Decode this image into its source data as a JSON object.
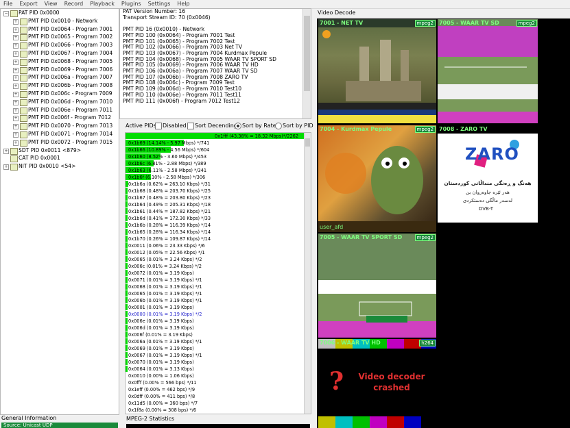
{
  "menu": [
    "File",
    "Export",
    "View",
    "Record",
    "Playback",
    "Plugins",
    "Settings",
    "Help"
  ],
  "tree": {
    "root": "PAT PID 0x0000",
    "children": [
      "PMT PID 0x0010 - Network",
      "PMT PID 0x0064 - Program 7001",
      "PMT PID 0x0065 - Program 7002",
      "PMT PID 0x0066 - Program 7003",
      "PMT PID 0x0067 - Program 7004",
      "PMT PID 0x0068 - Program 7005",
      "PMT PID 0x0069 - Program 7006",
      "PMT PID 0x006a - Program 7007",
      "PMT PID 0x006b - Program 7008",
      "PMT PID 0x006c - Program 7009",
      "PMT PID 0x006d - Program 7010",
      "PMT PID 0x006e - Program 7011",
      "PMT PID 0x006f - Program 7012",
      "PMT PID 0x0070 - Program 7013",
      "PMT PID 0x0071 - Program 7014",
      "PMT PID 0x0072 - Program 7015"
    ],
    "others": [
      "SDT PID 0x0011 <879>",
      "CAT PID 0x0001",
      "NIT PID 0x0010 <54>"
    ]
  },
  "general": {
    "label": "General Information",
    "source": "Source: Unicast UDP"
  },
  "pat_info": [
    "PAT Version Number: 16",
    "Transport Stream ID: 70 (0x0046)",
    "",
    "PMT PID 16 (0x0010) - Network",
    "PMT PID 100 (0x0064) - Program 7001 Test",
    "PMT PID 101 (0x0065) - Program 7002 Test",
    "PMT PID 102 (0x0066) - Program 7003 Net TV",
    "PMT PID 103 (0x0067) - Program 7004 Kurdmax Pepule",
    "PMT PID 104 (0x0068) - Program 7005 WAAR TV SPORT SD",
    "PMT PID 105 (0x0069) - Program 7006 WAAR TV HD",
    "PMT PID 106 (0x006a) - Program 7007 WAAR TV SD",
    "PMT PID 107 (0x006b) - Program 7008 ZARO TV",
    "PMT PID 108 (0x006c) - Program 7009 Test",
    "PMT PID 109 (0x006d) - Program 7010 Test10",
    "PMT PID 110 (0x006e) - Program 7011 Test11",
    "PMT PID 111 (0x006f) - Program 7012 Test12"
  ],
  "active": {
    "label": "Active PIDs",
    "disabled": "Disabled",
    "sort_desc": "Sort Decending",
    "sort_rate": "Sort by Rate",
    "sort_pid": "Sort by PID"
  },
  "pids": [
    {
      "t": "0x1fff (43.38% = 18.32 Mbps)*/2262",
      "p": 43.38
    },
    {
      "t": "0x1b69 (14.14% - 5.97 Mbps) */741",
      "p": 14.14
    },
    {
      "t": "0x1b66 (10.89% - 4.56 Mbps) */604",
      "p": 10.89
    },
    {
      "t": "0x1b60 (8.52% - 3.60 Mbps) */453",
      "p": 8.52
    },
    {
      "t": "0x1b6c (6.81% - 2.88 Mbps) */389",
      "p": 6.81
    },
    {
      "t": "0x1b63 (6.11% - 2.58 Mbps) */341",
      "p": 6.11
    },
    {
      "t": "0x1b6f (6.10% - 2.58 Mbps) */306",
      "p": 6.1
    },
    {
      "t": "0x1b6a (0.62% = 263.10 Kbps) */31",
      "p": 0.62
    },
    {
      "t": "0x1b68 (0.48% = 203.70 Kbps) */25",
      "p": 0.48
    },
    {
      "t": "0x1b67 (0.48% = 203.80 Kbps) */23",
      "p": 0.48
    },
    {
      "t": "0x1b64 (0.49% = 205.31 Kbps) */18",
      "p": 0.49
    },
    {
      "t": "0x1b61 (0.44% = 187.82 Kbps) */21",
      "p": 0.44
    },
    {
      "t": "0x1b6d (0.41% = 172.30 Kbps) */33",
      "p": 0.41
    },
    {
      "t": "0x1b6b (0.28% = 116.39 Kbps) */14",
      "p": 0.28
    },
    {
      "t": "0x1b65 (0.28% = 116.34 Kbps) */14",
      "p": 0.28
    },
    {
      "t": "0x1b70 (0.26% = 109.87 Kbps) */14",
      "p": 0.26
    },
    {
      "t": "0x0011 (0.06% = 23.33 Kbps) */6",
      "p": 0.06
    },
    {
      "t": "0x0012 (0.05% = 22.56 Kbps) */1",
      "p": 0.05
    },
    {
      "t": "0x0065 (0.01% = 3.24 Kbps) */2",
      "p": 0.01
    },
    {
      "t": "0x006c (0.01% = 3.24 Kbps) */2",
      "p": 0.01
    },
    {
      "t": "0x0072 (0.01% = 3.19 Kbps)",
      "p": 0.01
    },
    {
      "t": "0x0071 (0.01% = 3.19 Kbps) */1",
      "p": 0.01
    },
    {
      "t": "0x0068 (0.01% = 3.19 Kbps) */1",
      "p": 0.01
    },
    {
      "t": "0x0065 (0.01% = 3.19 Kbps) */1",
      "p": 0.01
    },
    {
      "t": "0x006b (0.01% = 3.19 Kbps) */1",
      "p": 0.01
    },
    {
      "t": "0x0001 (0.01% = 3.19 Kbps)",
      "p": 0.01
    },
    {
      "t": "0x0000 (0.01% = 3.19 Kbps) */2",
      "p": 0.01,
      "sel": true
    },
    {
      "t": "0x006e (0.01% = 3.19 Kbps)",
      "p": 0.01
    },
    {
      "t": "0x006d (0.01% = 3.19 Kbps)",
      "p": 0.01
    },
    {
      "t": "0x006f (0.01% = 3.19 Kbps)",
      "p": 0.01
    },
    {
      "t": "0x006a (0.01% = 3.19 Kbps) */1",
      "p": 0.01
    },
    {
      "t": "0x0069 (0.01% = 3.19 Kbps)",
      "p": 0.01
    },
    {
      "t": "0x0067 (0.01% = 3.19 Kbps) */1",
      "p": 0.01
    },
    {
      "t": "0x0070 (0.01% = 3.19 Kbps)",
      "p": 0.01
    },
    {
      "t": "0x0064 (0.01% = 3.13 Kbps)",
      "p": 0.01
    },
    {
      "t": "0x0010 (0.00% = 1.06 Kbps)",
      "p": 0.0
    },
    {
      "t": "0x0fff (0.00% = 566 bps) */11",
      "p": 0.0
    },
    {
      "t": "0x1eff (0.00% = 462 bps) */9",
      "p": 0.0
    },
    {
      "t": "0x0dff (0.00% = 411 bps) */8",
      "p": 0.0
    },
    {
      "t": "0x11d5 (0.00% = 360 bps) */7",
      "p": 0.0
    },
    {
      "t": "0x1f8a (0.00% = 308 bps) */6",
      "p": 0.0
    }
  ],
  "mpeg_label": "MPEG-2 Statistics",
  "video": {
    "label": "Video Decode",
    "tiles": [
      {
        "title": "7001 - NET TV",
        "codec": "mpeg2"
      },
      {
        "title": "7005 - WAAR TV SD",
        "codec": "mpeg2"
      },
      {
        "title": "7004 - Kurdmax Pepule",
        "codec": "mpeg2"
      },
      {
        "title": "7008 - ZARO TV",
        "codec": ""
      },
      {
        "title": "7005 - WAAR TV SPORT SD",
        "codec": "mpeg2"
      },
      {
        "title": "7006 - WAAR TV HD",
        "codec": "h264"
      }
    ],
    "zaro_logo": "ZARO",
    "zaro_text": [
      "ھەنگ و ڕەنگی منداڵانی کوردستان",
      "هەر ئێرە جاوەروان بن",
      "لەسەر ماڵگی دەستکردی",
      "DVB-T"
    ],
    "crash_message": "Video decoder crashed",
    "crash_icon": "?",
    "user_label": "user_afd",
    "colors": {
      "accent": "#7fff7f",
      "crash": "#e03030",
      "bar": "#00dd00"
    }
  }
}
